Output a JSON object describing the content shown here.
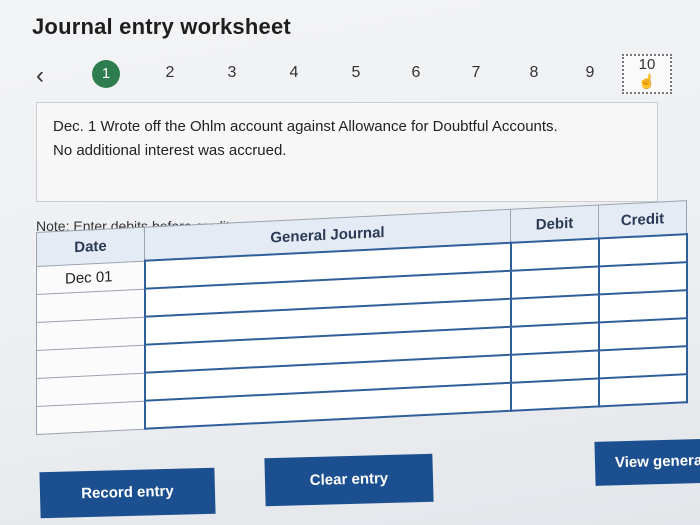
{
  "header": {
    "title": "Journal entry worksheet"
  },
  "stepper": {
    "prev_icon": "chevron-left-icon",
    "steps": [
      "1",
      "2",
      "3",
      "4",
      "5",
      "6",
      "7",
      "8",
      "9",
      "10"
    ],
    "active_step": "1"
  },
  "description": {
    "line1": "Dec. 1 Wrote off the Ohlm account against Allowance for Doubtful Accounts.",
    "line2": "No additional interest was accrued."
  },
  "note": "Note: Enter debits before credits.",
  "table": {
    "headers": {
      "date": "Date",
      "journal": "General Journal",
      "debit": "Debit",
      "credit": "Credit"
    },
    "rows": [
      {
        "date": "Dec 01",
        "journal": "",
        "debit": "",
        "credit": ""
      },
      {
        "date": "",
        "journal": "",
        "debit": "",
        "credit": ""
      },
      {
        "date": "",
        "journal": "",
        "debit": "",
        "credit": ""
      },
      {
        "date": "",
        "journal": "",
        "debit": "",
        "credit": ""
      },
      {
        "date": "",
        "journal": "",
        "debit": "",
        "credit": ""
      },
      {
        "date": "",
        "journal": "",
        "debit": "",
        "credit": ""
      }
    ]
  },
  "buttons": {
    "record": "Record entry",
    "clear": "Clear entry",
    "view": "View general"
  },
  "colors": {
    "accent": "#1c4f8f",
    "active_step": "#2e7d4f",
    "header_bg": "#e4ebf5"
  }
}
